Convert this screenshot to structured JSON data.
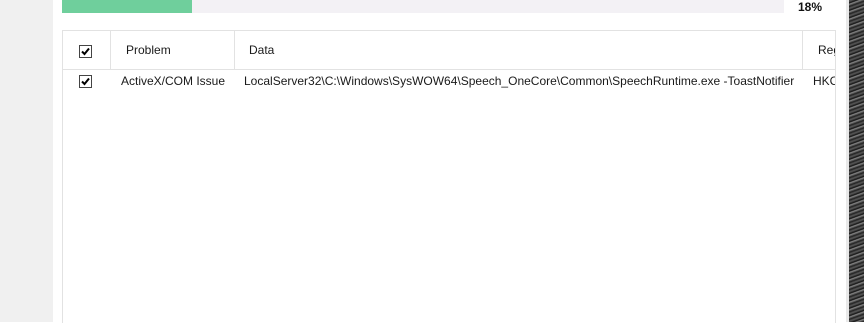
{
  "progress": {
    "value": 0.18,
    "label": "18%",
    "fill_color": "#6fcf9c",
    "track_color": "#f3f1f5"
  },
  "table": {
    "columns": [
      {
        "key": "select",
        "label": ""
      },
      {
        "key": "problem",
        "label": "Problem"
      },
      {
        "key": "data",
        "label": "Data"
      },
      {
        "key": "registry",
        "label": "Reg"
      }
    ],
    "header_checked": true,
    "rows": [
      {
        "checked": true,
        "problem": "ActiveX/COM Issue",
        "data": "LocalServer32\\C:\\Windows\\SysWOW64\\Speech_OneCore\\Common\\SpeechRuntime.exe -ToastNotifier",
        "registry": "HKC"
      }
    ]
  }
}
